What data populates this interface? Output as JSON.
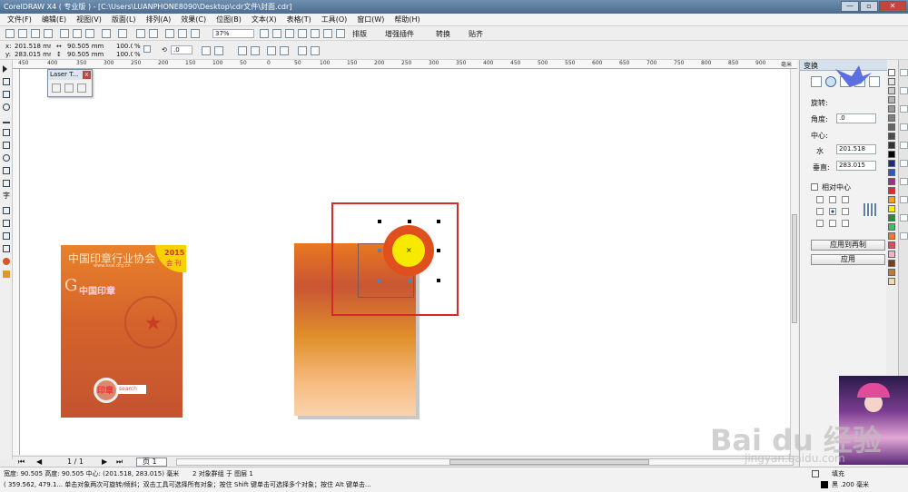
{
  "window": {
    "title": "CorelDRAW X4 ( 专业版 ) - [C:\\Users\\LUANPHONE8090\\Desktop\\cdr文件\\封面.cdr]",
    "minimize": "—",
    "maximize": "▫",
    "close": "✕"
  },
  "menu": [
    "文件(F)",
    "编辑(E)",
    "视图(V)",
    "版面(L)",
    "排列(A)",
    "效果(C)",
    "位图(B)",
    "文本(X)",
    "表格(T)",
    "工具(O)",
    "窗口(W)",
    "帮助(H)"
  ],
  "toolbar": {
    "zoom": "37%",
    "plugins": [
      "排版",
      "增强插件",
      "转换",
      "贴齐"
    ]
  },
  "propbar": {
    "x": "201.518 mm",
    "y": "283.015 mm",
    "w": "90.505 mm",
    "h": "90.505 mm",
    "scale_w": "100.0",
    "scale_h": "100.0",
    "pct": "%",
    "rotate": ".0",
    "x_label": "x:",
    "y_label": "y:"
  },
  "rulers": {
    "h_ticks": [
      "450",
      "400",
      "350",
      "300",
      "250",
      "200",
      "150",
      "100",
      "50",
      "0",
      "50",
      "100",
      "150",
      "200",
      "250",
      "300",
      "350",
      "400",
      "450",
      "500",
      "550",
      "600",
      "650",
      "700",
      "750",
      "800",
      "850",
      "900"
    ],
    "unit": "毫米"
  },
  "laser_dialog": {
    "title": "Laser T...",
    "close": "x"
  },
  "pager": {
    "current": "1 / 1",
    "tab": "页 1"
  },
  "status": {
    "line1": "宽度: 90.505  高度: 90.505  中心: (201.518, 283.015)  毫米",
    "objects": "2 对象群组 于 图层 1",
    "line2": "( 359.562, 479.1...  单击对象两次可旋转/倾斜；双击工具可选择所有对象；按住 Shift 键单击可选择多个对象；按住 Alt 键单击...",
    "fill_label": "填充",
    "outline_label": "黑 .200 毫米"
  },
  "docker": {
    "header": "变换",
    "rotate_label": "旋转:",
    "angle_label": "角度:",
    "angle_value": ".0",
    "center_label": "中心:",
    "h_label": "水",
    "h_value": "201.518",
    "v_label": "垂直:",
    "v_value": "283.015",
    "relative_center": "相对中心",
    "apply_copy": "应用到再制",
    "apply": "应用"
  },
  "cover_left": {
    "org": "中国印章行业协会",
    "url": "www.sxal.org.cn",
    "year": "2015",
    "issue": "会 刊",
    "brand": "中国印章",
    "search_label": "印章",
    "search_text": "search"
  },
  "watermark": {
    "main": "Bai du 经验",
    "sub": "jingyan.baidu.com"
  },
  "colors": {
    "accent_blue": "#4b6c90",
    "orange": "#e8771f",
    "yellow": "#f7ea00",
    "red_ring": "#e0501f",
    "selection": "#d12b2b"
  }
}
